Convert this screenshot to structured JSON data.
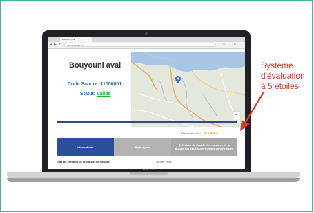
{
  "browser": {
    "tab_title": "Bouyouni aval",
    "url": "sierm.eaufrance.fr",
    "back_glyph": "◀",
    "forward_glyph": "▶",
    "reload_glyph": "↻",
    "bookmark_glyph": "☆",
    "menu_glyph": "≡"
  },
  "station": {
    "name": "Bouyouni aval",
    "code_text": "Code Sandre: 11000001",
    "status_label": "Statut:",
    "status_value": "Validé"
  },
  "map": {
    "description_icon": "map-pin-icon",
    "marker_color": "#3b6fd8"
  },
  "rating": {
    "label": "Notez cette fiche :",
    "stars": "★★★★★",
    "max": 5
  },
  "tabs": [
    {
      "label": "Informations",
      "active": true
    },
    {
      "label": "Historiques",
      "active": false
    },
    {
      "label": "Définition du finalité des mesures de la qualité des eaux superficielles continentales",
      "active": false
    }
  ],
  "details": {
    "date_label": "Date de création de la station de mesure",
    "date_value": "26 Feb 2008"
  },
  "laptop": {
    "brand": "MacBook Pro"
  },
  "callout": {
    "line1": "Système",
    "line2": "d'évaluation",
    "line3": "à 5 étoiles",
    "color": "#d63a2a"
  },
  "colors": {
    "accent_blue": "#2b4f9a",
    "status_green": "#1fae2f",
    "star_gold": "#f1a318",
    "frame_teal": "#3fb89a"
  }
}
